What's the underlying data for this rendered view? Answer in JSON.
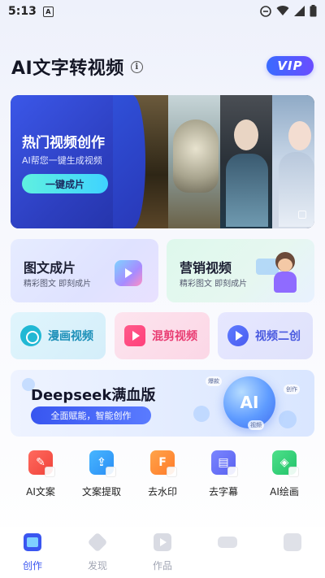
{
  "status_bar": {
    "time": "5:13",
    "notification_letter": "A"
  },
  "header": {
    "title": "AI文字转视频",
    "info_symbol": "i",
    "vip_label": "VIP"
  },
  "banner": {
    "title": "热门视频创作",
    "subtitle": "AI帮您一键生成视频",
    "button_label": "一键成片"
  },
  "cards": [
    {
      "title": "图文成片",
      "subtitle": "精彩图文 即刻成片"
    },
    {
      "title": "营销视频",
      "subtitle": "精彩图文 即刻成片"
    }
  ],
  "pills": [
    {
      "label": "漫画视频"
    },
    {
      "label": "混剪视频"
    },
    {
      "label": "视频二创"
    }
  ],
  "deepseek": {
    "title": "Deepseek满血版",
    "tag": "全面赋能，智能创作",
    "orb_label": "AI",
    "chips": [
      "爆款",
      "创作",
      "视频"
    ]
  },
  "tools": [
    {
      "label": "AI文案",
      "icon": "pen-icon"
    },
    {
      "label": "文案提取",
      "icon": "upload-icon"
    },
    {
      "label": "去水印",
      "icon": "watermark-icon"
    },
    {
      "label": "去字幕",
      "icon": "subtitle-icon"
    },
    {
      "label": "AI绘画",
      "icon": "paint-icon"
    }
  ],
  "tabbar": {
    "items": [
      {
        "label": "创作",
        "active": true
      },
      {
        "label": "发现",
        "active": false
      },
      {
        "label": "作品",
        "active": false
      }
    ]
  },
  "colors": {
    "accent": "#3a56f0",
    "vip": "#4a5cf0"
  }
}
